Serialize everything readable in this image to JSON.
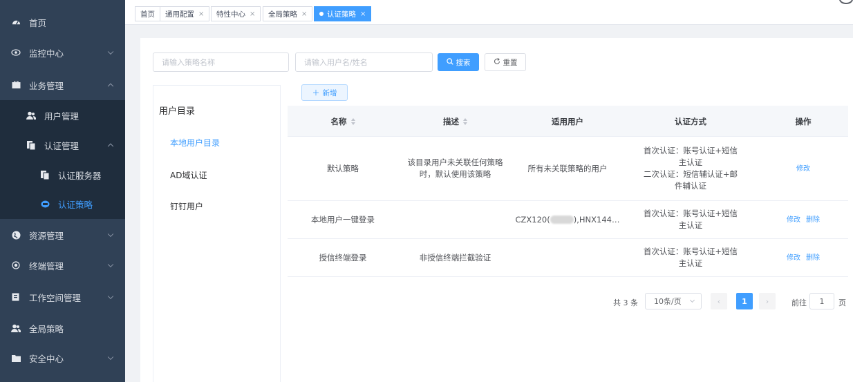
{
  "sidebar": {
    "items": [
      {
        "label": "首页",
        "icon": "dashboard-icon"
      },
      {
        "label": "监控中心",
        "icon": "eye-icon"
      },
      {
        "label": "业务管理",
        "icon": "briefcase-icon"
      },
      {
        "label": "用户管理",
        "icon": "users-icon"
      },
      {
        "label": "认证管理",
        "icon": "id-card-icon"
      },
      {
        "label": "认证服务器",
        "icon": "server-icon"
      },
      {
        "label": "认证策略",
        "icon": "policy-icon"
      },
      {
        "label": "资源管理",
        "icon": "globe-icon"
      },
      {
        "label": "终端管理",
        "icon": "target-icon"
      },
      {
        "label": "工作空间管理",
        "icon": "workspace-icon"
      },
      {
        "label": "全局策略",
        "icon": "users-icon"
      },
      {
        "label": "安全中心",
        "icon": "folder-icon"
      }
    ]
  },
  "tabs": [
    {
      "label": "首页"
    },
    {
      "label": "通用配置",
      "close": "×"
    },
    {
      "label": "特性中心",
      "close": "×"
    },
    {
      "label": "全局策略",
      "close": "×"
    },
    {
      "label": "认证策略",
      "close": "×",
      "active": true
    }
  ],
  "search": {
    "policy_placeholder": "请输入策略名称",
    "user_placeholder": "请输入用户名/姓名",
    "search_label": "搜索",
    "reset_label": "重置"
  },
  "add_label": "新增",
  "directory": {
    "title": "用户目录",
    "items": [
      "本地用户目录",
      "AD域认证",
      "钉钉用户"
    ]
  },
  "table": {
    "headers": [
      "名称",
      "描述",
      "适用用户",
      "认证方式",
      "操作"
    ],
    "rows": [
      {
        "name": "默认策略",
        "desc_lines": [
          "该目录用户未关联任何策略",
          "时，默认使用该策略"
        ],
        "users": "所有未关联策略的用户",
        "auth_lines": [
          "首次认证：账号认证+短信",
          "主认证",
          "二次认证：短信辅认证+邮",
          "件辅认证"
        ],
        "actions": [
          "修改"
        ]
      },
      {
        "name": "本地用户一键登录",
        "desc_lines": [],
        "users_prefix": "CZX120(",
        "users_suffix": "),HNX144…",
        "auth_lines": [
          "首次认证：账号认证+短信",
          "主认证"
        ],
        "actions": [
          "修改",
          "删除"
        ]
      },
      {
        "name": "授信终端登录",
        "desc_lines": [
          "非授信终端拦截验证"
        ],
        "users": "",
        "auth_lines": [
          "首次认证：账号认证+短信",
          "主认证"
        ],
        "actions": [
          "修改",
          "删除"
        ]
      }
    ]
  },
  "pagination": {
    "total": "共 3 条",
    "page_size": "10条/页",
    "current": "1",
    "goto_prefix": "前往",
    "goto_value": "1",
    "goto_suffix": "页"
  },
  "colors": {
    "accent": "#409eff",
    "sidebar_bg": "#304156",
    "submenu_bg": "#1f2d3d"
  }
}
